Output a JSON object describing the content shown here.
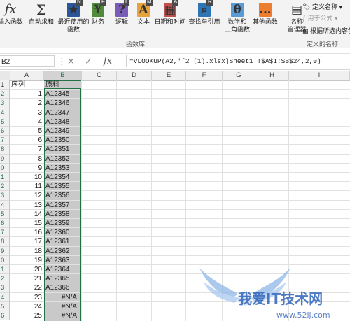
{
  "ribbon": {
    "buttons": [
      {
        "label1": "插入函数",
        "label2": "",
        "icon": "fx",
        "keytip": ""
      },
      {
        "label1": "自动求和",
        "label2": "",
        "icon": "Σ",
        "keytip": ""
      },
      {
        "label1": "最近使用的",
        "label2": "函数",
        "icon": "★",
        "keytip": "N",
        "color": "#2b579a"
      },
      {
        "label1": "财务",
        "label2": "",
        "icon": "¥",
        "keytip": "F",
        "color": "#4e8c3a"
      },
      {
        "label1": "逻辑",
        "label2": "",
        "icon": "?",
        "keytip": "L",
        "color": "#7a5bb5"
      },
      {
        "label1": "文本",
        "label2": "",
        "icon": "A",
        "keytip": "M",
        "color": "#e6a23c"
      },
      {
        "label1": "日期和时间",
        "label2": "",
        "icon": "▦",
        "keytip": "A",
        "color": "#c0504d"
      },
      {
        "label1": "查找与引用",
        "label2": "",
        "icon": "⌕",
        "keytip": "R",
        "color": "#2e75b6"
      },
      {
        "label1": "数学和",
        "label2": "三角函数",
        "icon": "θ",
        "keytip": "",
        "color": "#5b9bd5"
      },
      {
        "label1": "其他函数",
        "label2": "",
        "icon": "…",
        "keytip": "",
        "color": "#ed7d31"
      },
      {
        "label1": "名称",
        "label2": "管理器",
        "icon": "▤",
        "keytip": ""
      }
    ],
    "group_function_library": "函数库",
    "group_defined_names": "定义的名称",
    "define_name": "定义名称",
    "use_in_formula": "用于公式",
    "create_from_selection": "根据所选内容创"
  },
  "formula_bar": {
    "name_box": "B2",
    "formula": "=VLOOKUP(A2,'[2 (1).xlsx]Sheet1'!$A$1:$B$24,2,0)"
  },
  "columns": [
    "A",
    "B",
    "C",
    "D",
    "E",
    "F",
    "G",
    "H",
    "I"
  ],
  "row_headers": [
    "1",
    "2",
    "3",
    "4",
    "5",
    "6",
    "7",
    "8",
    "9",
    "0",
    "1",
    "2",
    "3",
    "4",
    "5",
    "6",
    "7",
    "8",
    "9",
    "0",
    "1",
    "2",
    "3",
    "4",
    "5",
    "6"
  ],
  "header_row": {
    "a": "序列",
    "b": "原料"
  },
  "rows": [
    {
      "a": "1",
      "b": "A12345"
    },
    {
      "a": "2",
      "b": "A12346"
    },
    {
      "a": "3",
      "b": "A12347"
    },
    {
      "a": "4",
      "b": "A12348"
    },
    {
      "a": "5",
      "b": "A12349"
    },
    {
      "a": "6",
      "b": "A12350"
    },
    {
      "a": "7",
      "b": "A12351"
    },
    {
      "a": "8",
      "b": "A12352"
    },
    {
      "a": "9",
      "b": "A12353"
    },
    {
      "a": "10",
      "b": "A12354"
    },
    {
      "a": "11",
      "b": "A12355"
    },
    {
      "a": "12",
      "b": "A12356"
    },
    {
      "a": "13",
      "b": "A12357"
    },
    {
      "a": "14",
      "b": "A12358"
    },
    {
      "a": "15",
      "b": "A12359"
    },
    {
      "a": "16",
      "b": "A12360"
    },
    {
      "a": "17",
      "b": "A12361"
    },
    {
      "a": "18",
      "b": "A12362"
    },
    {
      "a": "19",
      "b": "A12363"
    },
    {
      "a": "20",
      "b": "A12364"
    },
    {
      "a": "21",
      "b": "A12365"
    },
    {
      "a": "22",
      "b": "A12366"
    },
    {
      "a": "23",
      "b": "#N/A"
    },
    {
      "a": "24",
      "b": "#N/A"
    },
    {
      "a": "25",
      "b": "#N/A"
    }
  ],
  "watermark": {
    "title": "我爱IT技术网",
    "url": "www.52ij.com"
  },
  "colors": {
    "accent": "#217346",
    "selection": "#c9c9c9"
  }
}
